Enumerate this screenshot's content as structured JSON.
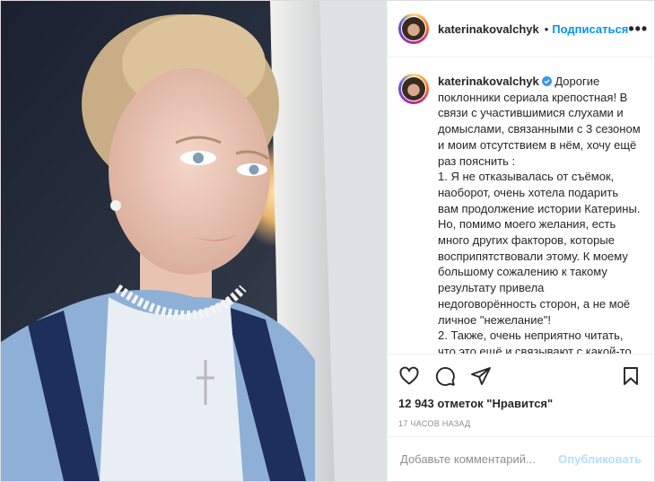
{
  "header": {
    "username": "katerinakovalchyk",
    "separator": "•",
    "follow_label": "Подписаться",
    "more_label": "•••"
  },
  "caption": {
    "username": "katerinakovalchyk",
    "text": "Дорогие поклонники сериала крепостная! В связи с участившимися слухами и домыслами, связанными с 3 сезоном и моим отсутствием в нём, хочу ещё раз пояснить :\n1. Я не отказывалась от съёмок, наоборот, очень хотела подарить вам продолжение истории Катерины. Но, помимо моего желания, есть много других факторов, которые восприпятствовали этому. К моему большому сожалению к такому результату привела недоговорённость сторон, а не моё личное \"нежелание\"!\n2. Также, очень неприятно читать, что это ещё и связывают с какой-то политикой, якобы я была в Крыму ("
  },
  "actions": {
    "like_icon": "heart-icon",
    "comment_icon": "comment-icon",
    "share_icon": "share-icon",
    "save_icon": "bookmark-icon"
  },
  "likes_text": "12 943 отметок \"Нравится\"",
  "timestamp": "17 часов назад",
  "comment": {
    "placeholder": "Добавьте комментарий...",
    "publish_label": "Опубликовать"
  },
  "colors": {
    "accent": "#0095f6",
    "publish_disabled": "#b2dffc",
    "verified": "#3897f0"
  }
}
